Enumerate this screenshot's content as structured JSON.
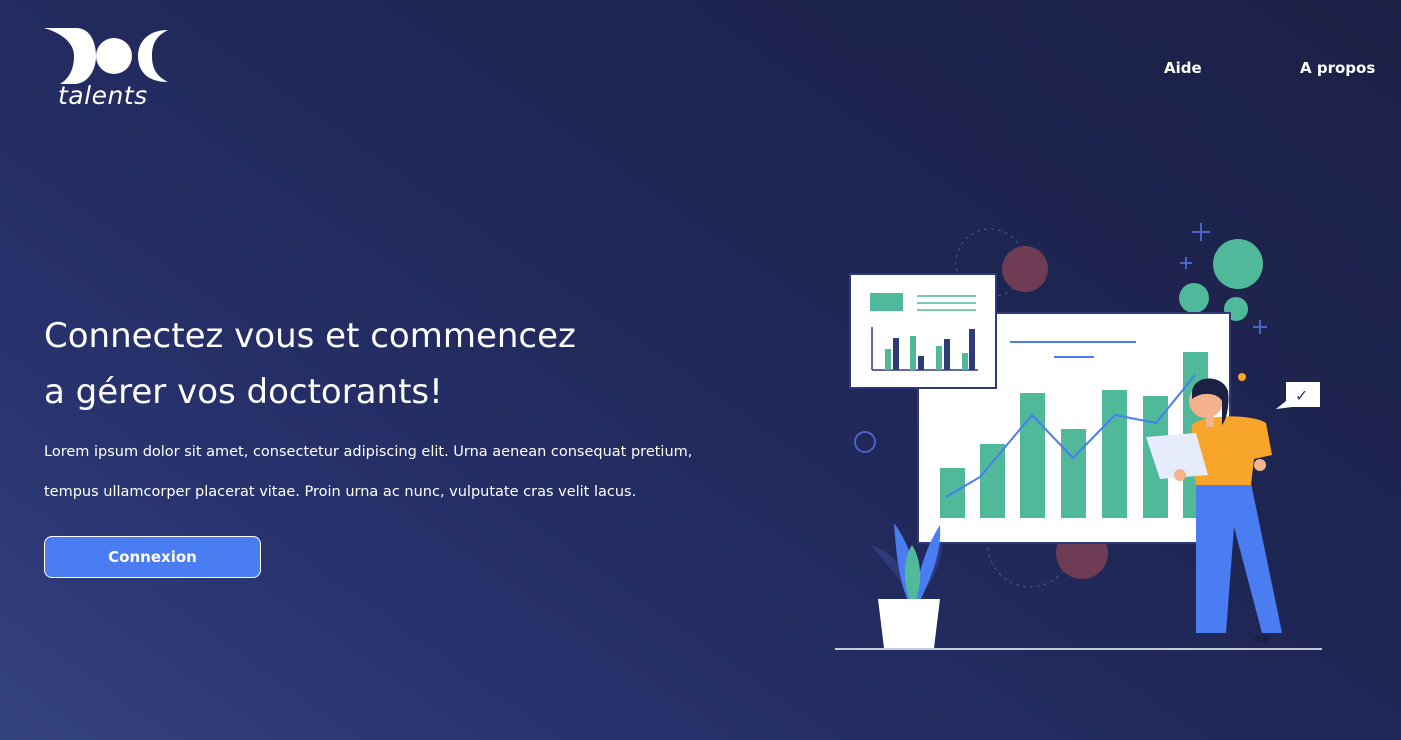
{
  "brand": {
    "logo_text": "talents"
  },
  "nav": {
    "aide": "Aide",
    "apropos": "A propos"
  },
  "hero": {
    "title_line1": "Connectez vous et commencez",
    "title_line2": "a gérer vos doctorants!",
    "text_line1": "Lorem ipsum dolor sit amet, consectetur adipiscing elit. Urna aenean consequat pretium,",
    "text_line2": "tempus ullamcorper placerat vitae. Proin urna ac nunc, vulputate cras velit lacus.",
    "button": "Connexion"
  },
  "illustration": {
    "checkmark": "✓",
    "colors": {
      "teal": "#4fb99a",
      "navy": "#2f3a7a",
      "blue": "#4a7df2",
      "orange": "#f7a52b",
      "maroon": "#6e3d55"
    }
  },
  "theme": {
    "accent": "#4a7df2",
    "background": "#242c5e"
  }
}
